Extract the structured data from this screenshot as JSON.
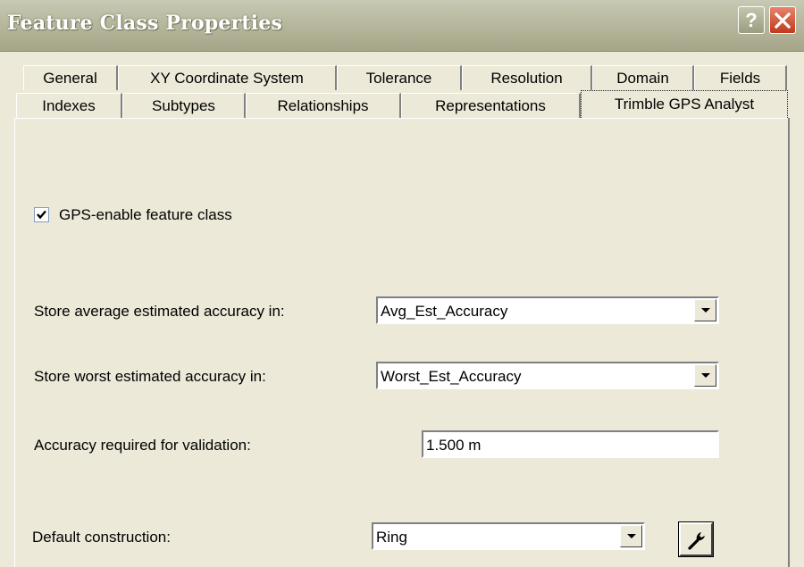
{
  "window": {
    "title": "Feature Class Properties"
  },
  "title_buttons": {
    "help": "?"
  },
  "tabs_row1": [
    "General",
    "XY Coordinate System",
    "Tolerance",
    "Resolution",
    "Domain",
    "Fields"
  ],
  "tabs_row2": [
    "Indexes",
    "Subtypes",
    "Relationships",
    "Representations",
    "Trimble GPS Analyst"
  ],
  "active_tab": "Trimble GPS Analyst",
  "panel": {
    "gps_enable": {
      "label": "GPS-enable feature class",
      "checked": true
    },
    "avg_accuracy": {
      "label": "Store average estimated accuracy in:",
      "value": "Avg_Est_Accuracy"
    },
    "worst_accuracy": {
      "label": "Store worst estimated accuracy in:",
      "value": "Worst_Est_Accuracy"
    },
    "validation": {
      "label": "Accuracy required for validation:",
      "value": "1.500 m"
    },
    "construction": {
      "label": "Default construction:",
      "value": "Ring"
    }
  },
  "icons": {
    "help": "question-mark-icon",
    "close": "close-x-icon",
    "check": "checkmark-icon",
    "dropdown": "triangle-down-icon",
    "tool": "wrench-icon"
  }
}
